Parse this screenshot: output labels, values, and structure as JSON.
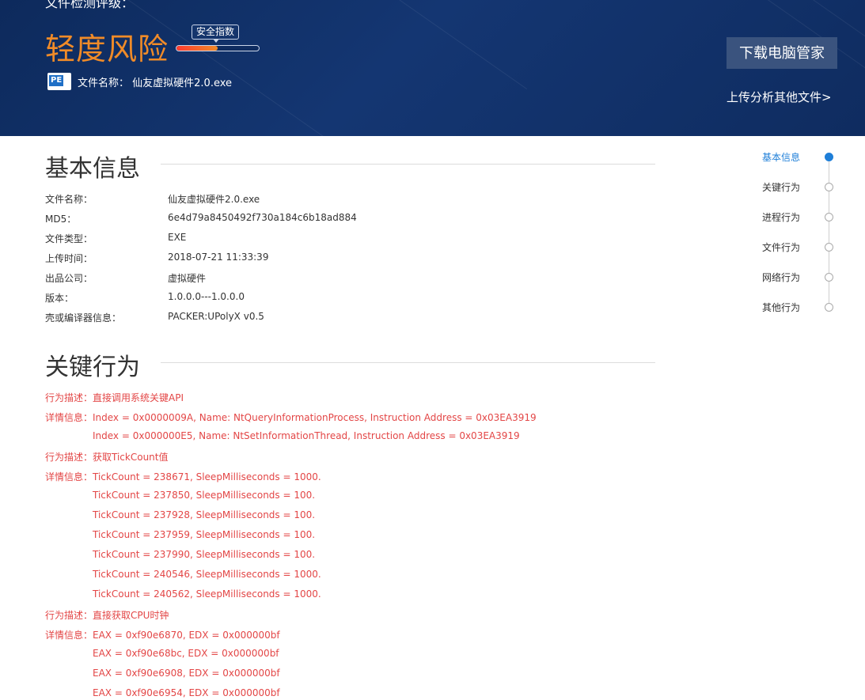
{
  "header": {
    "cut_title": "文件检测评级：",
    "risk_level": "轻度风险",
    "badge": "安全指数",
    "meter_fraction": 0.5,
    "pe_label": "PE",
    "file_label": "文件名称：",
    "file_name": "仙友虚拟硬件2.0.exe",
    "download_button": "下载电脑管家",
    "upload_link": "上传分析其他文件>"
  },
  "basic_info": {
    "title": "基本信息",
    "rows": [
      {
        "key": "文件名称：",
        "value": "仙友虚拟硬件2.0.exe"
      },
      {
        "key": "MD5：",
        "value": "6e4d79a8450492f730a184c6b18ad884"
      },
      {
        "key": "文件类型：",
        "value": "EXE"
      },
      {
        "key": "上传时间：",
        "value": "2018-07-21 11:33:39"
      },
      {
        "key": "出品公司：",
        "value": "虚拟硬件"
      },
      {
        "key": "版本：",
        "value": "1.0.0.0---1.0.0.0"
      },
      {
        "key": "壳或编译器信息：",
        "value": "PACKER:UPolyX v0.5"
      }
    ]
  },
  "key_behavior": {
    "title": "关键行为",
    "lines": [
      "行为描述：直接调用系统关键API",
      "详情信息：Index = 0x0000009A, Name: NtQueryInformationProcess, Instruction Address = 0x03EA3919",
      "Index = 0x000000E5, Name: NtSetInformationThread, Instruction Address = 0x03EA3919",
      "行为描述：获取TickCount值",
      "详情信息：TickCount = 238671, SleepMilliseconds = 1000.",
      "TickCount = 237850, SleepMilliseconds = 100.",
      "TickCount = 237928, SleepMilliseconds = 100.",
      "TickCount = 237959, SleepMilliseconds = 100.",
      "TickCount = 237990, SleepMilliseconds = 100.",
      "TickCount = 240546, SleepMilliseconds = 1000.",
      "TickCount = 240562, SleepMilliseconds = 1000.",
      "行为描述：直接获取CPU时钟",
      "详情信息：EAX = 0xf90e6870, EDX = 0x000000bf",
      "EAX = 0xf90e68bc, EDX = 0x000000bf",
      "EAX = 0xf90e6908, EDX = 0x000000bf",
      "EAX = 0xf90e6954, EDX = 0x000000bf"
    ]
  },
  "side_nav": {
    "items": [
      "基本信息",
      "关键行为",
      "进程行为",
      "文件行为",
      "网络行为",
      "其他行为"
    ],
    "active": "基本信息"
  },
  "colors": {
    "header_bg": "#0f2c60",
    "risk_orange": "#f08b28",
    "behavior_red": "#e34646",
    "nav_active": "#1f7fd8"
  }
}
